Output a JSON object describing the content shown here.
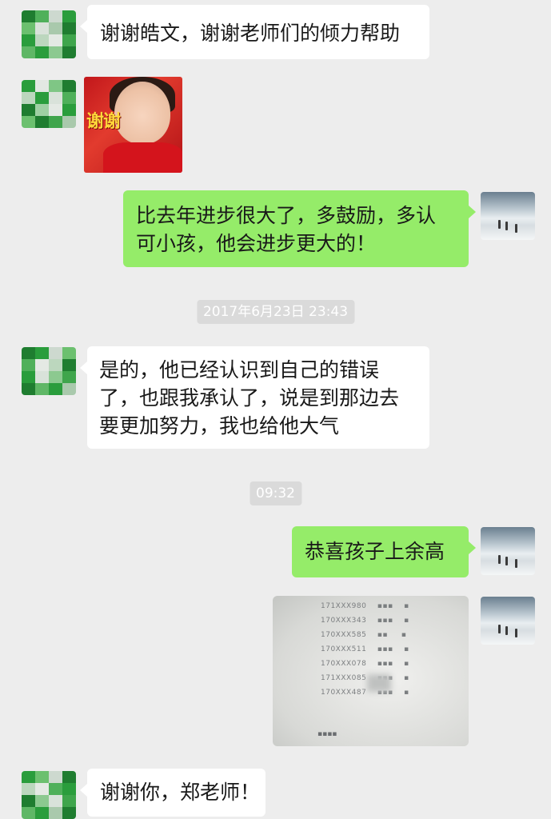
{
  "chat": {
    "messages": [
      {
        "id": "m1",
        "side": "in",
        "type": "text",
        "text": "谢谢皓文，谢谢老师们的倾力帮助"
      },
      {
        "id": "m2",
        "side": "in",
        "type": "sticker",
        "caption": "谢谢"
      },
      {
        "id": "m3",
        "side": "out",
        "type": "text",
        "text": "比去年进步很大了，多鼓励，多认\n可小孩，他会进步更大的！"
      },
      {
        "id": "m4",
        "side": "in",
        "type": "text",
        "text": "是的，他已经认识到自己的错误\n了，也跟我承认了，说是到那边去\n要更加努力，我也给他大气"
      },
      {
        "id": "m5",
        "side": "out",
        "type": "text",
        "text": "恭喜孩子上余高"
      },
      {
        "id": "m6",
        "side": "out",
        "type": "image"
      },
      {
        "id": "m7",
        "side": "in",
        "type": "text",
        "text": "谢谢你，郑老师！"
      }
    ],
    "timestamps": [
      "2017年6月23日 23:43",
      "09:32"
    ]
  },
  "avatars": {
    "contact": {
      "icon": "pixelated-avatar",
      "colors": [
        "#2a9d3c",
        "#6cc06f",
        "#c7d8c9",
        "#1f7d30"
      ]
    },
    "self": {
      "icon": "snowy-mountain-avatar"
    }
  },
  "colors": {
    "background": "#ededed",
    "incoming_bubble": "#ffffff",
    "outgoing_bubble": "#95ec69",
    "timestamp_bg": "#dadada"
  }
}
